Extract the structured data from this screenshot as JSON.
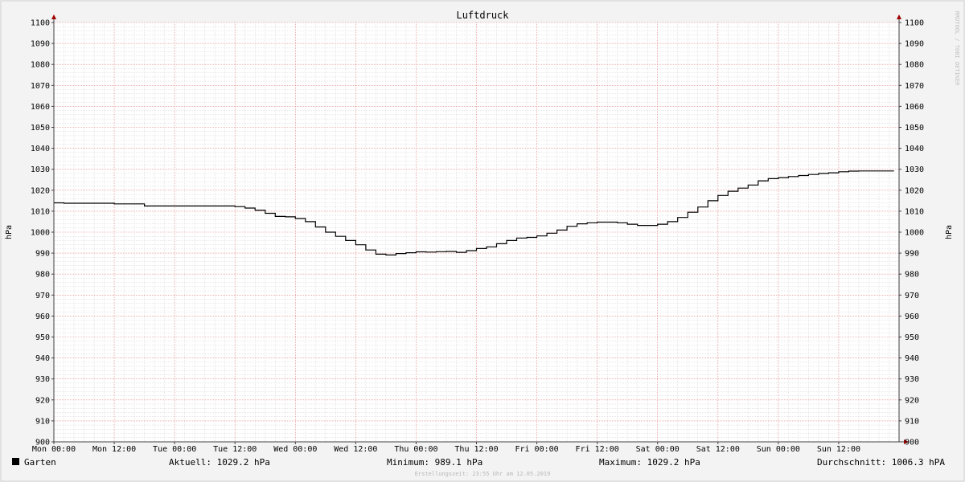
{
  "chart_data": {
    "type": "line",
    "title": "Luftdruck",
    "ylabel_left": "hPa",
    "ylabel_right": "hPa",
    "ylim": [
      900,
      1100
    ],
    "y_ticks": [
      900,
      910,
      920,
      930,
      940,
      950,
      960,
      970,
      980,
      990,
      1000,
      1010,
      1020,
      1030,
      1040,
      1050,
      1060,
      1070,
      1080,
      1090,
      1100
    ],
    "y_tick_labels": [
      "900",
      "910",
      "920",
      "930",
      "940",
      "950",
      "960",
      "970",
      "980",
      "990",
      "1000",
      "1010",
      "1020",
      "1030",
      "1040",
      "1050",
      "1060",
      "1070",
      "1080",
      "1090",
      "1100"
    ],
    "x_ticks": [
      "Mon 00:00",
      "Mon 12:00",
      "Tue 00:00",
      "Tue 12:00",
      "Wed 00:00",
      "Wed 12:00",
      "Thu 00:00",
      "Thu 12:00",
      "Fri 00:00",
      "Fri 12:00",
      "Sat 00:00",
      "Sat 12:00",
      "Sun 00:00",
      "Sun 12:00"
    ],
    "x_unit": "hours from Mon 00:00",
    "x_range": [
      0,
      168
    ],
    "grid": true,
    "series": [
      {
        "name": "Garten",
        "color": "#000000",
        "x": [
          0,
          2,
          6,
          12,
          18,
          24,
          30,
          36,
          38,
          40,
          42,
          44,
          46,
          48,
          50,
          52,
          54,
          56,
          58,
          60,
          62,
          64,
          66,
          68,
          70,
          72,
          74,
          76,
          78,
          80,
          82,
          84,
          86,
          88,
          90,
          92,
          94,
          96,
          98,
          100,
          102,
          104,
          106,
          108,
          110,
          112,
          114,
          116,
          118,
          120,
          122,
          124,
          126,
          128,
          130,
          132,
          134,
          136,
          138,
          140,
          142,
          144,
          146,
          148,
          150,
          152,
          154,
          156,
          158,
          160,
          162,
          164,
          166,
          167
        ],
        "values": [
          1014,
          1013.8,
          1013.8,
          1013.5,
          1012.5,
          1012.5,
          1012.5,
          1012.2,
          1011.5,
          1010.5,
          1009,
          1007.5,
          1007.3,
          1006.5,
          1005,
          1002.5,
          1000,
          998,
          996,
          994,
          991.5,
          989.5,
          989.1,
          989.8,
          990.2,
          990.6,
          990.5,
          990.7,
          990.8,
          990.4,
          991.2,
          992.2,
          993,
          994.5,
          996,
          997.2,
          997.5,
          998.2,
          999.5,
          1001,
          1002.8,
          1004,
          1004.5,
          1004.8,
          1004.8,
          1004.5,
          1003.8,
          1003.2,
          1003.2,
          1003.8,
          1005,
          1007,
          1009.5,
          1012,
          1015,
          1017.5,
          1019.5,
          1021,
          1022.5,
          1024.5,
          1025.5,
          1026,
          1026.5,
          1027,
          1027.5,
          1028,
          1028.3,
          1028.8,
          1029.1,
          1029.2,
          1029.2,
          1029.2,
          1029.2,
          1029.2
        ]
      }
    ]
  },
  "legend": {
    "series_name": "Garten",
    "current": "Aktuell: 1029.2 hPa",
    "minimum": "Minimum: 989.1 hPa",
    "maximum": "Maximum: 1029.2 hPa",
    "average": "Durchschnitt: 1006.3 hPA"
  },
  "watermark": "RRDTOOL / TOBI OETIKER",
  "footer": "Erstellungszeit: 23:55 Uhr am 12.05.2019",
  "colors": {
    "background": "#f3f3f3",
    "plot_background": "#ffffff",
    "major_grid": "#e08080",
    "minor_grid": "#d0d0d0",
    "axis_arrow": "#a00000",
    "line": "#000000"
  }
}
